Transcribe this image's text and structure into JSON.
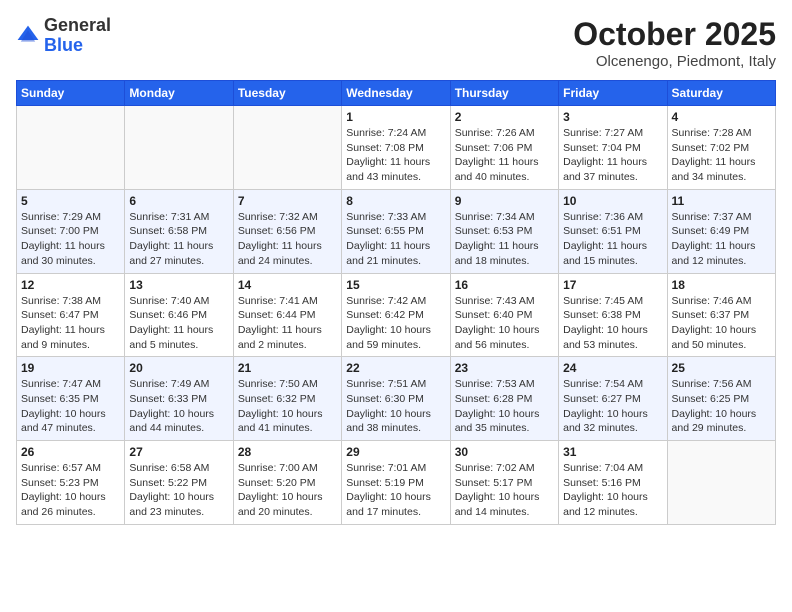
{
  "header": {
    "logo_general": "General",
    "logo_blue": "Blue",
    "month_title": "October 2025",
    "location": "Olcenengo, Piedmont, Italy"
  },
  "days_of_week": [
    "Sunday",
    "Monday",
    "Tuesday",
    "Wednesday",
    "Thursday",
    "Friday",
    "Saturday"
  ],
  "weeks": [
    [
      {
        "day": "",
        "info": ""
      },
      {
        "day": "",
        "info": ""
      },
      {
        "day": "",
        "info": ""
      },
      {
        "day": "1",
        "info": "Sunrise: 7:24 AM\nSunset: 7:08 PM\nDaylight: 11 hours\nand 43 minutes."
      },
      {
        "day": "2",
        "info": "Sunrise: 7:26 AM\nSunset: 7:06 PM\nDaylight: 11 hours\nand 40 minutes."
      },
      {
        "day": "3",
        "info": "Sunrise: 7:27 AM\nSunset: 7:04 PM\nDaylight: 11 hours\nand 37 minutes."
      },
      {
        "day": "4",
        "info": "Sunrise: 7:28 AM\nSunset: 7:02 PM\nDaylight: 11 hours\nand 34 minutes."
      }
    ],
    [
      {
        "day": "5",
        "info": "Sunrise: 7:29 AM\nSunset: 7:00 PM\nDaylight: 11 hours\nand 30 minutes."
      },
      {
        "day": "6",
        "info": "Sunrise: 7:31 AM\nSunset: 6:58 PM\nDaylight: 11 hours\nand 27 minutes."
      },
      {
        "day": "7",
        "info": "Sunrise: 7:32 AM\nSunset: 6:56 PM\nDaylight: 11 hours\nand 24 minutes."
      },
      {
        "day": "8",
        "info": "Sunrise: 7:33 AM\nSunset: 6:55 PM\nDaylight: 11 hours\nand 21 minutes."
      },
      {
        "day": "9",
        "info": "Sunrise: 7:34 AM\nSunset: 6:53 PM\nDaylight: 11 hours\nand 18 minutes."
      },
      {
        "day": "10",
        "info": "Sunrise: 7:36 AM\nSunset: 6:51 PM\nDaylight: 11 hours\nand 15 minutes."
      },
      {
        "day": "11",
        "info": "Sunrise: 7:37 AM\nSunset: 6:49 PM\nDaylight: 11 hours\nand 12 minutes."
      }
    ],
    [
      {
        "day": "12",
        "info": "Sunrise: 7:38 AM\nSunset: 6:47 PM\nDaylight: 11 hours\nand 9 minutes."
      },
      {
        "day": "13",
        "info": "Sunrise: 7:40 AM\nSunset: 6:46 PM\nDaylight: 11 hours\nand 5 minutes."
      },
      {
        "day": "14",
        "info": "Sunrise: 7:41 AM\nSunset: 6:44 PM\nDaylight: 11 hours\nand 2 minutes."
      },
      {
        "day": "15",
        "info": "Sunrise: 7:42 AM\nSunset: 6:42 PM\nDaylight: 10 hours\nand 59 minutes."
      },
      {
        "day": "16",
        "info": "Sunrise: 7:43 AM\nSunset: 6:40 PM\nDaylight: 10 hours\nand 56 minutes."
      },
      {
        "day": "17",
        "info": "Sunrise: 7:45 AM\nSunset: 6:38 PM\nDaylight: 10 hours\nand 53 minutes."
      },
      {
        "day": "18",
        "info": "Sunrise: 7:46 AM\nSunset: 6:37 PM\nDaylight: 10 hours\nand 50 minutes."
      }
    ],
    [
      {
        "day": "19",
        "info": "Sunrise: 7:47 AM\nSunset: 6:35 PM\nDaylight: 10 hours\nand 47 minutes."
      },
      {
        "day": "20",
        "info": "Sunrise: 7:49 AM\nSunset: 6:33 PM\nDaylight: 10 hours\nand 44 minutes."
      },
      {
        "day": "21",
        "info": "Sunrise: 7:50 AM\nSunset: 6:32 PM\nDaylight: 10 hours\nand 41 minutes."
      },
      {
        "day": "22",
        "info": "Sunrise: 7:51 AM\nSunset: 6:30 PM\nDaylight: 10 hours\nand 38 minutes."
      },
      {
        "day": "23",
        "info": "Sunrise: 7:53 AM\nSunset: 6:28 PM\nDaylight: 10 hours\nand 35 minutes."
      },
      {
        "day": "24",
        "info": "Sunrise: 7:54 AM\nSunset: 6:27 PM\nDaylight: 10 hours\nand 32 minutes."
      },
      {
        "day": "25",
        "info": "Sunrise: 7:56 AM\nSunset: 6:25 PM\nDaylight: 10 hours\nand 29 minutes."
      }
    ],
    [
      {
        "day": "26",
        "info": "Sunrise: 6:57 AM\nSunset: 5:23 PM\nDaylight: 10 hours\nand 26 minutes."
      },
      {
        "day": "27",
        "info": "Sunrise: 6:58 AM\nSunset: 5:22 PM\nDaylight: 10 hours\nand 23 minutes."
      },
      {
        "day": "28",
        "info": "Sunrise: 7:00 AM\nSunset: 5:20 PM\nDaylight: 10 hours\nand 20 minutes."
      },
      {
        "day": "29",
        "info": "Sunrise: 7:01 AM\nSunset: 5:19 PM\nDaylight: 10 hours\nand 17 minutes."
      },
      {
        "day": "30",
        "info": "Sunrise: 7:02 AM\nSunset: 5:17 PM\nDaylight: 10 hours\nand 14 minutes."
      },
      {
        "day": "31",
        "info": "Sunrise: 7:04 AM\nSunset: 5:16 PM\nDaylight: 10 hours\nand 12 minutes."
      },
      {
        "day": "",
        "info": ""
      }
    ]
  ]
}
